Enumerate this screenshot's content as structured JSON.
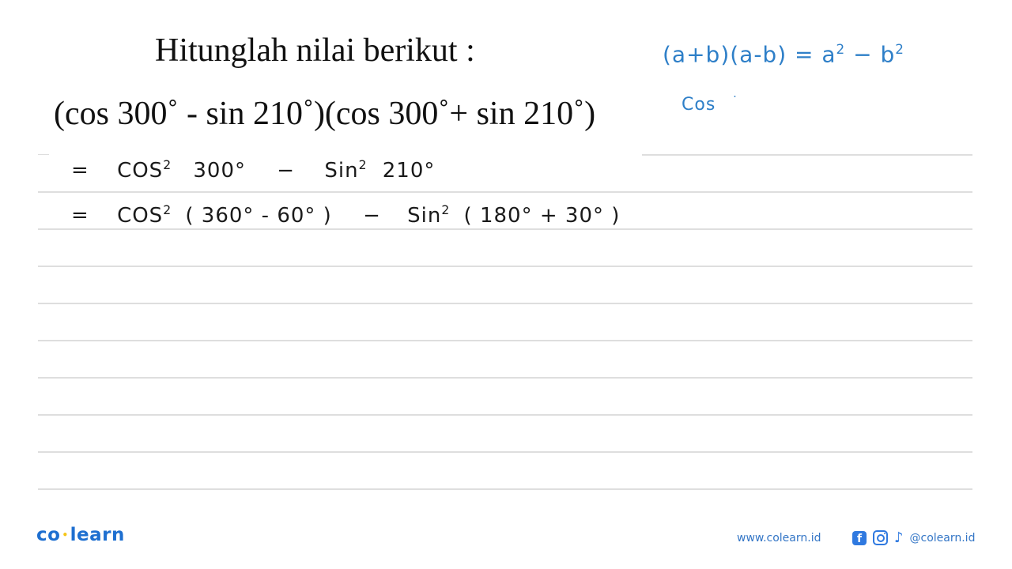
{
  "question": {
    "prompt": "Hitunglah nilai berikut :",
    "expression": "(cos 300˚ - sin 210˚)(cos 300˚+ sin 210˚)"
  },
  "side_notes": {
    "identity_lhs": "(a+b)(a-b) = a",
    "identity_exp1": "2",
    "identity_mid": " − b",
    "identity_exp2": "2",
    "partial": "Cos",
    "partial_dot": "·"
  },
  "working": [
    {
      "eq": "=",
      "t1": "COS",
      "t1_exp": "2",
      "t1_arg": "300°",
      "op": "−",
      "t2": "Sin",
      "t2_exp": "2",
      "t2_arg": "210°"
    },
    {
      "eq": "=",
      "t1": "COS",
      "t1_exp": "2",
      "t1_arg": "( 360° - 60° )",
      "op": "−",
      "t2": "Sin",
      "t2_exp": "2",
      "t2_arg": "( 180° + 30° )"
    }
  ],
  "footer": {
    "brand_left": "co",
    "brand_dot": "•",
    "brand_right": "learn",
    "website": "www.colearn.id",
    "social_icons": [
      "facebook-icon",
      "instagram-icon",
      "tiktok-icon"
    ],
    "facebook_glyph": "f",
    "tiktok_glyph": "♪",
    "handle": "@colearn.id"
  },
  "colors": {
    "ink_blue": "#2e7fc8",
    "brand_blue": "#1e6fd0",
    "brand_accent": "#f5c518",
    "rule_gray": "#dedede"
  }
}
